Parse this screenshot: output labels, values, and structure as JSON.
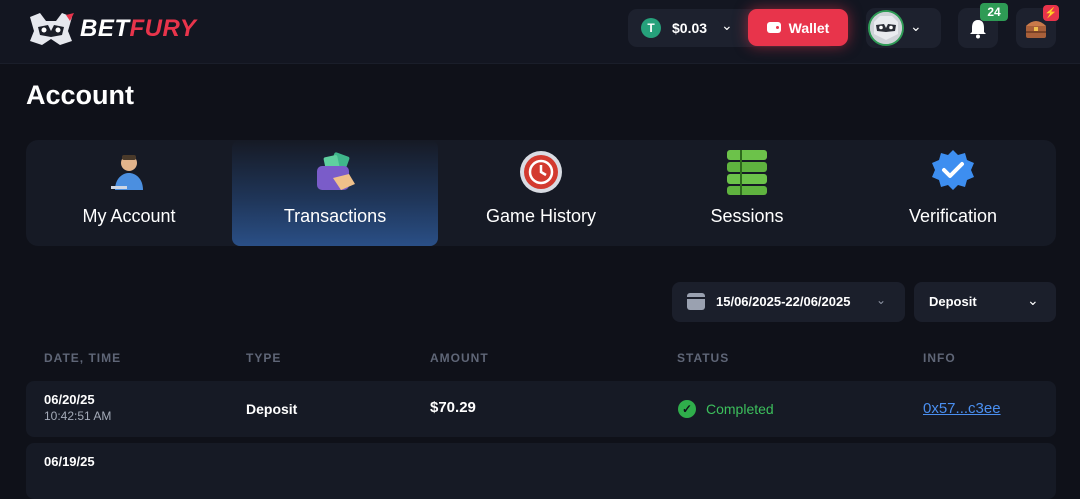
{
  "header": {
    "logo": {
      "bet": "BET",
      "fury": "FURY"
    },
    "balance": {
      "currency_icon": "T",
      "amount": "$0.03"
    },
    "wallet_label": "Wallet",
    "notifications_count": "24",
    "chest_badge_icon": "bolt-icon"
  },
  "page": {
    "title": "Account"
  },
  "tabs": [
    {
      "label": "My Account",
      "icon": "user-icon"
    },
    {
      "label": "Transactions",
      "icon": "wallet-cards-icon",
      "active": true
    },
    {
      "label": "Game History",
      "icon": "history-clock-icon"
    },
    {
      "label": "Sessions",
      "icon": "server-stack-icon"
    },
    {
      "label": "Verification",
      "icon": "verified-badge-icon"
    }
  ],
  "filters": {
    "date_range": "15/06/2025-22/06/2025",
    "type": "Deposit"
  },
  "table": {
    "headers": [
      "DATE, TIME",
      "TYPE",
      "AMOUNT",
      "STATUS",
      "INFO"
    ],
    "rows": [
      {
        "date": "06/20/25",
        "time": "10:42:51 AM",
        "type": "Deposit",
        "amount": "$70.29",
        "status": "Completed",
        "info": "0x57...c3ee"
      },
      {
        "date": "06/19/25",
        "time": "",
        "type": "",
        "amount": "",
        "status": "",
        "info": ""
      }
    ]
  },
  "colors": {
    "accent": "#e8344b",
    "success": "#3cbf5c",
    "link": "#4a8ff0",
    "background": "#0f1119",
    "panel": "#161a25"
  }
}
